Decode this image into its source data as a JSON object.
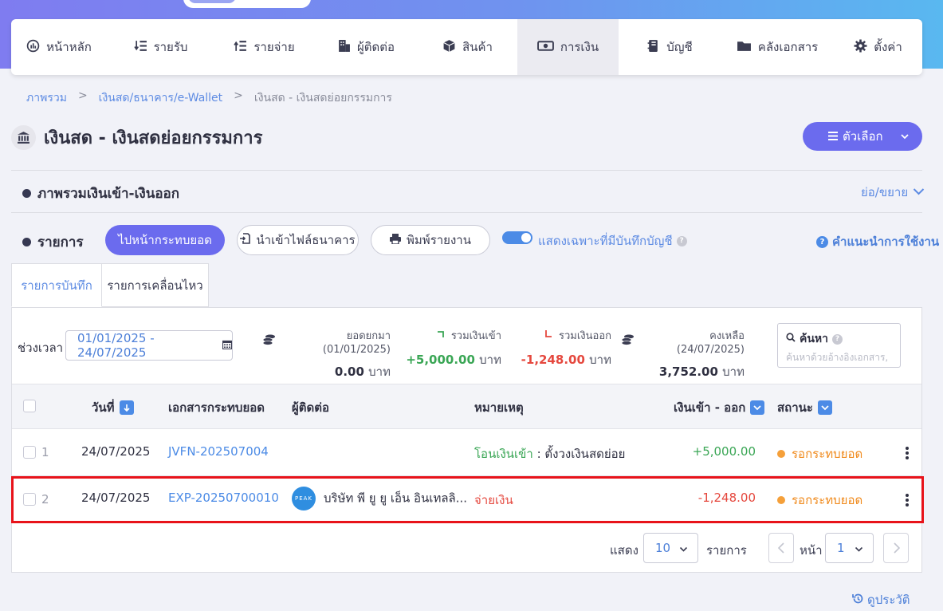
{
  "nav": {
    "items": [
      {
        "label": "หน้าหลัก",
        "icon": "dashboard-icon",
        "active": false
      },
      {
        "label": "รายรับ",
        "icon": "income-icon",
        "active": false
      },
      {
        "label": "รายจ่าย",
        "icon": "expense-icon",
        "active": false
      },
      {
        "label": "ผู้ติดต่อ",
        "icon": "contacts-icon",
        "active": false
      },
      {
        "label": "สินค้า",
        "icon": "box-icon",
        "active": false
      },
      {
        "label": "การเงิน",
        "icon": "money-icon",
        "active": true
      },
      {
        "label": "บัญชี",
        "icon": "ledger-icon",
        "active": false
      },
      {
        "label": "คลังเอกสาร",
        "icon": "folder-icon",
        "active": false
      },
      {
        "label": "ตั้งค่า",
        "icon": "gear-icon",
        "active": false
      }
    ]
  },
  "breadcrumb": {
    "home": "ภาพรวม",
    "sep": ">",
    "parent": "เงินสด/ธนาคาร/e-Wallet",
    "current": "เงินสด - เงินสดย่อยกรรมการ"
  },
  "page": {
    "title": "เงินสด - เงินสดย่อยกรรมการ",
    "options_label": "ตัวเลือก",
    "overview_title": "ภาพรวมเงินเข้า-เงินออก",
    "collapse_label": "ย่อ/ขยาย",
    "list_title": "รายการ",
    "btn_reconcile": "ไปหน้ากระทบยอด",
    "btn_import": "นำเข้าไฟล์ธนาคาร",
    "btn_print": "พิมพ์รายงาน",
    "toggle_label": "แสดงเฉพาะที่มีบันทึกบัญชี",
    "guide_label": "คำแนะนำการใช้งาน",
    "history_label": "ดูประวัติ"
  },
  "tabs": [
    {
      "label": "รายการบันทึก",
      "active": true
    },
    {
      "label": "รายการเคลื่อนไหว",
      "active": false
    }
  ],
  "filters": {
    "period_label": "ช่วงเวลา",
    "period_value": "01/01/2025 - 24/07/2025",
    "search_label": "ค้นหา",
    "search_placeholder": "ค้นหาด้วยอ้างอิงเอกสาร,"
  },
  "stats": {
    "opening": {
      "label": "ยอดยกมา (01/01/2025)",
      "value": "0.00",
      "unit": "บาท"
    },
    "in": {
      "label": "รวมเงินเข้า",
      "value": "+5,000.00",
      "unit": "บาท"
    },
    "out": {
      "label": "รวมเงินออก",
      "value": "-1,248.00",
      "unit": "บาท"
    },
    "balance": {
      "label": "คงเหลือ (24/07/2025)",
      "value": "3,752.00",
      "unit": "บาท"
    }
  },
  "table": {
    "headers": {
      "date": "วันที่",
      "doc": "เอกสารกระทบยอด",
      "contact": "ผู้ติดต่อ",
      "note": "หมายเหตุ",
      "amount": "เงินเข้า - ออก",
      "status": "สถานะ"
    },
    "rows": [
      {
        "no": "1",
        "date": "24/07/2025",
        "doc": "JVFN-202507004",
        "contact": "",
        "note_type": "โอนเงินเข้า",
        "note_sep": " : ",
        "note_detail": "ตั้งวงเงินสดย่อย",
        "amount": "+5,000.00",
        "status": "รอกระทบยอด"
      },
      {
        "no": "2",
        "date": "24/07/2025",
        "doc": "EXP-20250700010",
        "contact": "บริษัท พี ยู ยู เอ็น อินเทลลิ...",
        "avatar": "PEAK",
        "note_type": "จ่ายเงิน",
        "note_sep": "",
        "note_detail": "",
        "amount": "-1,248.00",
        "status": "รอกระทบยอด"
      }
    ]
  },
  "pagination": {
    "show_label": "แสดง",
    "per_page": "10",
    "items_label": "รายการ",
    "page_label": "หน้า",
    "page": "1"
  },
  "colors": {
    "primary": "#6b6bee",
    "link": "#4c8be6",
    "positive": "#3aa655",
    "negative": "#e5483e",
    "pending": "#f5a03a",
    "highlight": "#e8131a"
  }
}
